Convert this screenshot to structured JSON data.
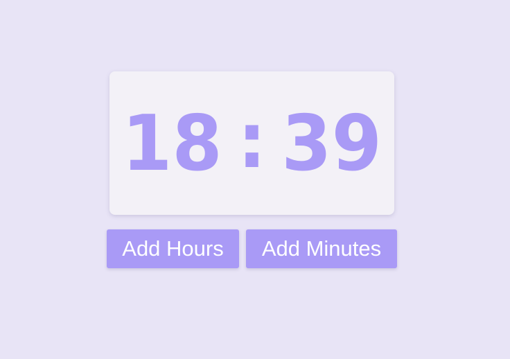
{
  "clock": {
    "hours": "18",
    "separator": ":",
    "minutes": "39"
  },
  "buttons": {
    "add_hours_label": "Add Hours",
    "add_minutes_label": "Add Minutes"
  },
  "colors": {
    "background": "#e8e4f6",
    "card": "#f3f1f7",
    "accent": "#a99af6",
    "button_text": "#ffffff"
  }
}
